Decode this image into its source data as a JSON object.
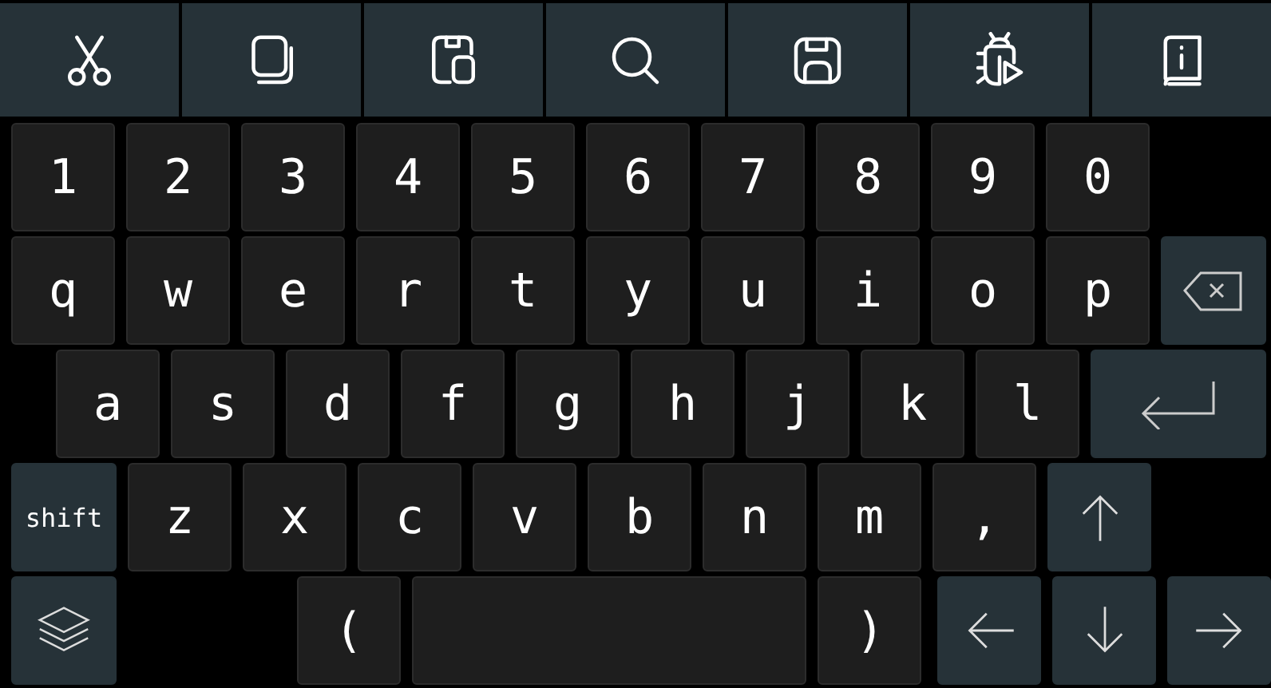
{
  "toolbar": [
    {
      "kind": "cut"
    },
    {
      "kind": "copy"
    },
    {
      "kind": "paste"
    },
    {
      "kind": "search"
    },
    {
      "kind": "save"
    },
    {
      "kind": "debug"
    },
    {
      "kind": "info"
    }
  ],
  "rows": [
    {
      "keys": [
        {
          "kind": "char",
          "label": "1"
        },
        {
          "kind": "char",
          "label": "2"
        },
        {
          "kind": "char",
          "label": "3"
        },
        {
          "kind": "char",
          "label": "4"
        },
        {
          "kind": "char",
          "label": "5"
        },
        {
          "kind": "char",
          "label": "6"
        },
        {
          "kind": "char",
          "label": "7"
        },
        {
          "kind": "char",
          "label": "8"
        },
        {
          "kind": "char",
          "label": "9"
        },
        {
          "kind": "char",
          "label": "0"
        }
      ]
    },
    {
      "keys": [
        {
          "kind": "char",
          "label": "q"
        },
        {
          "kind": "char",
          "label": "w"
        },
        {
          "kind": "char",
          "label": "e"
        },
        {
          "kind": "char",
          "label": "r"
        },
        {
          "kind": "char",
          "label": "t"
        },
        {
          "kind": "char",
          "label": "y"
        },
        {
          "kind": "char",
          "label": "u"
        },
        {
          "kind": "char",
          "label": "i"
        },
        {
          "kind": "char",
          "label": "o"
        },
        {
          "kind": "char",
          "label": "p"
        },
        {
          "kind": "backspace"
        }
      ]
    },
    {
      "keys": [
        {
          "kind": "char",
          "label": "a"
        },
        {
          "kind": "char",
          "label": "s"
        },
        {
          "kind": "char",
          "label": "d"
        },
        {
          "kind": "char",
          "label": "f"
        },
        {
          "kind": "char",
          "label": "g"
        },
        {
          "kind": "char",
          "label": "h"
        },
        {
          "kind": "char",
          "label": "j"
        },
        {
          "kind": "char",
          "label": "k"
        },
        {
          "kind": "char",
          "label": "l"
        },
        {
          "kind": "enter"
        }
      ]
    },
    {
      "keys": [
        {
          "kind": "shift",
          "label": "shift"
        },
        {
          "kind": "char",
          "label": "z"
        },
        {
          "kind": "char",
          "label": "x"
        },
        {
          "kind": "char",
          "label": "c"
        },
        {
          "kind": "char",
          "label": "v"
        },
        {
          "kind": "char",
          "label": "b"
        },
        {
          "kind": "char",
          "label": "n"
        },
        {
          "kind": "char",
          "label": "m"
        },
        {
          "kind": "char",
          "label": ","
        },
        {
          "kind": "up"
        }
      ]
    },
    {
      "keys": [
        {
          "kind": "layers"
        },
        {
          "kind": "char",
          "label": "("
        },
        {
          "kind": "space"
        },
        {
          "kind": "char",
          "label": ")"
        },
        {
          "kind": "left"
        },
        {
          "kind": "down"
        },
        {
          "kind": "right"
        }
      ]
    }
  ]
}
